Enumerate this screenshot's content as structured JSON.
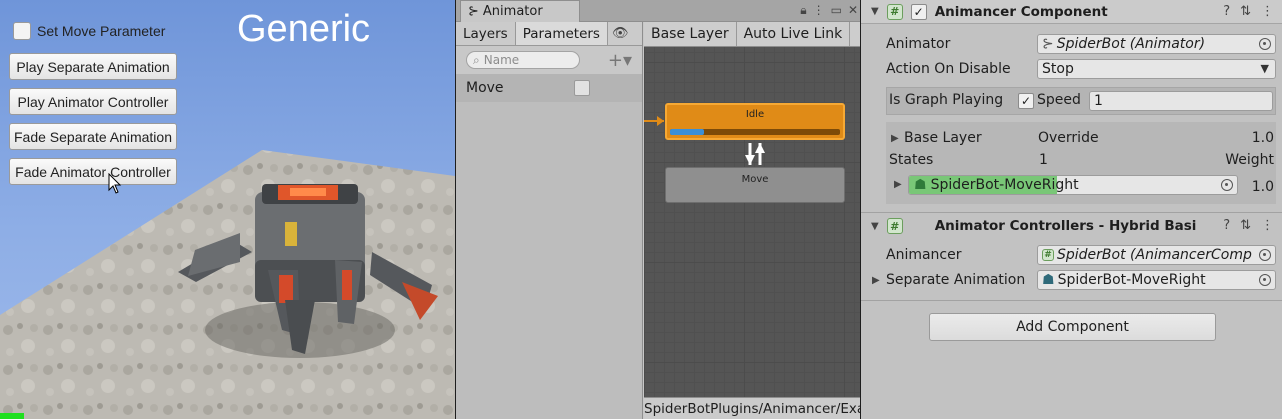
{
  "game": {
    "title": "Generic",
    "checkbox_label": "Set Move Parameter",
    "buttons": [
      "Play Separate Animation",
      "Play Animator Controller",
      "Fade Separate Animation",
      "Fade Animator Controller"
    ]
  },
  "animator": {
    "tab_title": "Animator",
    "left_tabs": [
      "Layers",
      "Parameters"
    ],
    "search_placeholder": "Name",
    "parameter": {
      "name": "Move",
      "checked": false
    },
    "graph_tabs": [
      "Base Layer",
      "Auto Live Link"
    ],
    "states": {
      "idle": "Idle",
      "move": "Move"
    },
    "idle_progress": 0.2,
    "footer_path": "SpiderBotPlugins/Animancer/Exa"
  },
  "inspector": {
    "component1": {
      "title": "Animancer Component",
      "animator_label": "Animator",
      "animator_value": "SpiderBot (Animator)",
      "action_label": "Action On Disable",
      "action_value": "Stop",
      "graph_playing_label": "Is Graph Playing",
      "speed_label": "Speed",
      "speed_value": "1",
      "layer_label": "Base Layer",
      "layer_mode": "Override",
      "layer_weight": "1.0",
      "states_label": "States",
      "states_count": "1",
      "weight_label": "Weight",
      "clip_name": "SpiderBot-MoveRight",
      "clip_weight": "1.0",
      "clip_progress": 0.45
    },
    "component2": {
      "title": "Animator Controllers - Hybrid Basi",
      "animancer_label": "Animancer",
      "animancer_value": "SpiderBot (AnimancerComp",
      "separate_label": "Separate Animation",
      "separate_value": "SpiderBot-MoveRight"
    },
    "add_component": "Add Component"
  }
}
